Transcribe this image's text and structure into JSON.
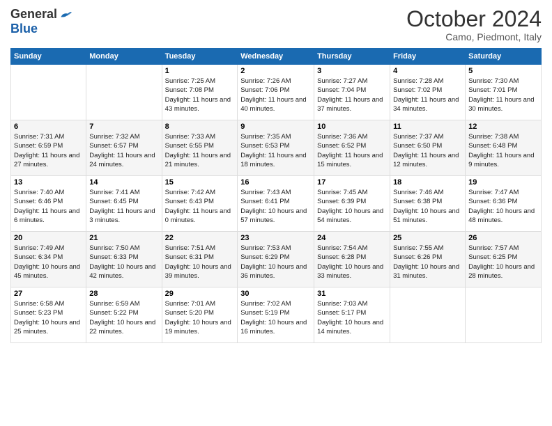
{
  "header": {
    "logo_general": "General",
    "logo_blue": "Blue",
    "month_title": "October 2024",
    "subtitle": "Camo, Piedmont, Italy"
  },
  "days_of_week": [
    "Sunday",
    "Monday",
    "Tuesday",
    "Wednesday",
    "Thursday",
    "Friday",
    "Saturday"
  ],
  "weeks": [
    [
      {
        "day": "",
        "info": ""
      },
      {
        "day": "",
        "info": ""
      },
      {
        "day": "1",
        "info": "Sunrise: 7:25 AM\nSunset: 7:08 PM\nDaylight: 11 hours and 43 minutes."
      },
      {
        "day": "2",
        "info": "Sunrise: 7:26 AM\nSunset: 7:06 PM\nDaylight: 11 hours and 40 minutes."
      },
      {
        "day": "3",
        "info": "Sunrise: 7:27 AM\nSunset: 7:04 PM\nDaylight: 11 hours and 37 minutes."
      },
      {
        "day": "4",
        "info": "Sunrise: 7:28 AM\nSunset: 7:02 PM\nDaylight: 11 hours and 34 minutes."
      },
      {
        "day": "5",
        "info": "Sunrise: 7:30 AM\nSunset: 7:01 PM\nDaylight: 11 hours and 30 minutes."
      }
    ],
    [
      {
        "day": "6",
        "info": "Sunrise: 7:31 AM\nSunset: 6:59 PM\nDaylight: 11 hours and 27 minutes."
      },
      {
        "day": "7",
        "info": "Sunrise: 7:32 AM\nSunset: 6:57 PM\nDaylight: 11 hours and 24 minutes."
      },
      {
        "day": "8",
        "info": "Sunrise: 7:33 AM\nSunset: 6:55 PM\nDaylight: 11 hours and 21 minutes."
      },
      {
        "day": "9",
        "info": "Sunrise: 7:35 AM\nSunset: 6:53 PM\nDaylight: 11 hours and 18 minutes."
      },
      {
        "day": "10",
        "info": "Sunrise: 7:36 AM\nSunset: 6:52 PM\nDaylight: 11 hours and 15 minutes."
      },
      {
        "day": "11",
        "info": "Sunrise: 7:37 AM\nSunset: 6:50 PM\nDaylight: 11 hours and 12 minutes."
      },
      {
        "day": "12",
        "info": "Sunrise: 7:38 AM\nSunset: 6:48 PM\nDaylight: 11 hours and 9 minutes."
      }
    ],
    [
      {
        "day": "13",
        "info": "Sunrise: 7:40 AM\nSunset: 6:46 PM\nDaylight: 11 hours and 6 minutes."
      },
      {
        "day": "14",
        "info": "Sunrise: 7:41 AM\nSunset: 6:45 PM\nDaylight: 11 hours and 3 minutes."
      },
      {
        "day": "15",
        "info": "Sunrise: 7:42 AM\nSunset: 6:43 PM\nDaylight: 11 hours and 0 minutes."
      },
      {
        "day": "16",
        "info": "Sunrise: 7:43 AM\nSunset: 6:41 PM\nDaylight: 10 hours and 57 minutes."
      },
      {
        "day": "17",
        "info": "Sunrise: 7:45 AM\nSunset: 6:39 PM\nDaylight: 10 hours and 54 minutes."
      },
      {
        "day": "18",
        "info": "Sunrise: 7:46 AM\nSunset: 6:38 PM\nDaylight: 10 hours and 51 minutes."
      },
      {
        "day": "19",
        "info": "Sunrise: 7:47 AM\nSunset: 6:36 PM\nDaylight: 10 hours and 48 minutes."
      }
    ],
    [
      {
        "day": "20",
        "info": "Sunrise: 7:49 AM\nSunset: 6:34 PM\nDaylight: 10 hours and 45 minutes."
      },
      {
        "day": "21",
        "info": "Sunrise: 7:50 AM\nSunset: 6:33 PM\nDaylight: 10 hours and 42 minutes."
      },
      {
        "day": "22",
        "info": "Sunrise: 7:51 AM\nSunset: 6:31 PM\nDaylight: 10 hours and 39 minutes."
      },
      {
        "day": "23",
        "info": "Sunrise: 7:53 AM\nSunset: 6:29 PM\nDaylight: 10 hours and 36 minutes."
      },
      {
        "day": "24",
        "info": "Sunrise: 7:54 AM\nSunset: 6:28 PM\nDaylight: 10 hours and 33 minutes."
      },
      {
        "day": "25",
        "info": "Sunrise: 7:55 AM\nSunset: 6:26 PM\nDaylight: 10 hours and 31 minutes."
      },
      {
        "day": "26",
        "info": "Sunrise: 7:57 AM\nSunset: 6:25 PM\nDaylight: 10 hours and 28 minutes."
      }
    ],
    [
      {
        "day": "27",
        "info": "Sunrise: 6:58 AM\nSunset: 5:23 PM\nDaylight: 10 hours and 25 minutes."
      },
      {
        "day": "28",
        "info": "Sunrise: 6:59 AM\nSunset: 5:22 PM\nDaylight: 10 hours and 22 minutes."
      },
      {
        "day": "29",
        "info": "Sunrise: 7:01 AM\nSunset: 5:20 PM\nDaylight: 10 hours and 19 minutes."
      },
      {
        "day": "30",
        "info": "Sunrise: 7:02 AM\nSunset: 5:19 PM\nDaylight: 10 hours and 16 minutes."
      },
      {
        "day": "31",
        "info": "Sunrise: 7:03 AM\nSunset: 5:17 PM\nDaylight: 10 hours and 14 minutes."
      },
      {
        "day": "",
        "info": ""
      },
      {
        "day": "",
        "info": ""
      }
    ]
  ]
}
